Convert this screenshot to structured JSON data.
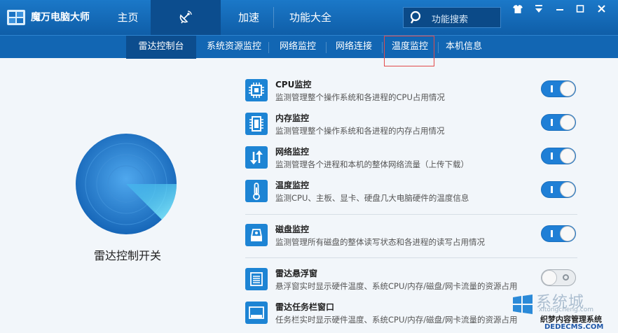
{
  "app": {
    "title": "魔万电脑大师"
  },
  "main_tabs": [
    {
      "label": "主页"
    },
    {
      "label": "",
      "icon": "satellite-dish-icon",
      "active": true
    },
    {
      "label": "加速"
    },
    {
      "label": "功能大全"
    }
  ],
  "search": {
    "placeholder": "功能搜索"
  },
  "window_controls": [
    "shirt-icon",
    "menu-icon",
    "minimize-icon",
    "maximize-icon",
    "close-icon"
  ],
  "sub_tabs": [
    {
      "label": "雷达控制台",
      "active": true
    },
    {
      "label": "系统资源监控"
    },
    {
      "label": "网络监控"
    },
    {
      "label": "网络连接"
    },
    {
      "label": "温度监控"
    },
    {
      "label": "本机信息"
    }
  ],
  "radar": {
    "label": "雷达控制开关"
  },
  "monitors": [
    {
      "title": "CPU监控",
      "desc": "监测管理整个操作系统和各进程的CPU占用情况",
      "icon": "cpu-chip-icon",
      "enabled": true
    },
    {
      "title": "内存监控",
      "desc": "监测管理整个操作系统和各进程的内存占用情况",
      "icon": "memory-icon",
      "enabled": true
    },
    {
      "title": "网络监控",
      "desc": "监测管理各个进程和本机的整体网络流量（上传下载）",
      "icon": "up-down-arrows-icon",
      "enabled": true
    },
    {
      "title": "温度监控",
      "desc": "监测CPU、主板、显卡、硬盘几大电脑硬件的温度信息",
      "icon": "thermometer-icon",
      "enabled": true
    },
    {
      "title": "磁盘监控",
      "desc": "监测管理所有磁盘的整体读写状态和各进程的读写占用情况",
      "icon": "disk-icon",
      "enabled": true
    },
    {
      "title": "雷达悬浮窗",
      "desc": "悬浮窗实时显示硬件温度、系统CPU/内存/磁盘/网卡流量的资源占用",
      "icon": "floating-window-icon",
      "enabled": false
    },
    {
      "title": "雷达任务栏窗口",
      "desc": "任务栏实时显示硬件温度、系统CPU/内存/磁盘/网卡流量的资源占用",
      "icon": "taskbar-window-icon",
      "enabled": false
    }
  ],
  "watermark": {
    "brand": "系统城",
    "url": "xitongcheng.com",
    "line2": "织梦内容管理系统",
    "line3": "DEDECMS.COM"
  },
  "colors": {
    "titlebar": "#1671c0",
    "accent": "#1f7fd6",
    "active_tab": "#0c4d8e",
    "highlight": "#e24a4a"
  }
}
